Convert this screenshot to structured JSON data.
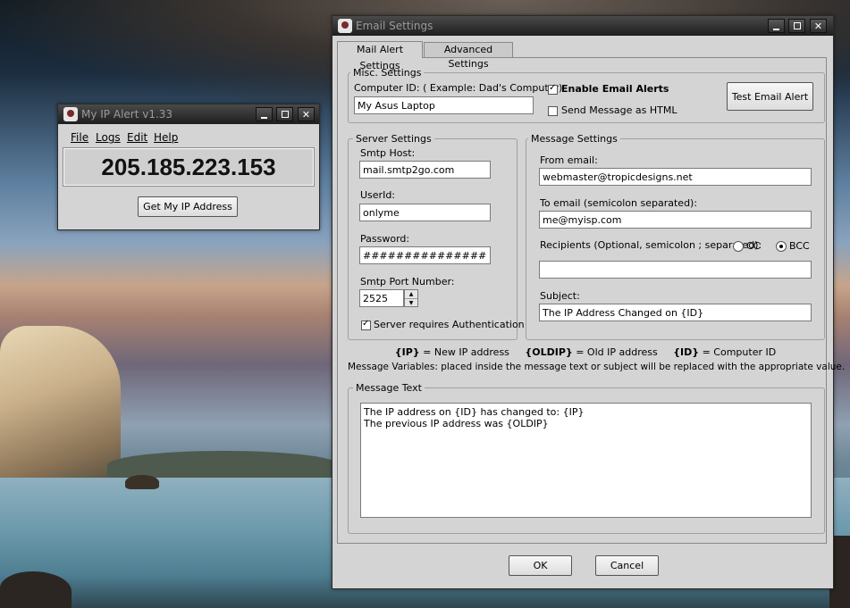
{
  "ipwin": {
    "title": "My IP Alert v1.33",
    "menu": [
      "File",
      "Logs",
      "Edit",
      "Help"
    ],
    "ip": "205.185.223.153",
    "get_ip_button": "Get My IP Address"
  },
  "email": {
    "title": "Email Settings",
    "tabs": [
      "Mail Alert Settings",
      "Advanced Settings"
    ],
    "misc": {
      "legend": "Misc. Settings",
      "computer_id_label": "Computer ID: ( Example: Dad's Computer)",
      "computer_id_value": "My Asus Laptop",
      "enable_alerts_label": "Enable Email Alerts",
      "send_html_label": "Send Message as HTML",
      "test_button": "Test Email Alert"
    },
    "server": {
      "legend": "Server Settings",
      "smtp_host_label": "Smtp Host:",
      "smtp_host_value": "mail.smtp2go.com",
      "userid_label": "UserId:",
      "userid_value": "onlyme",
      "password_label": "Password:",
      "password_value": "#################",
      "port_label": "Smtp Port Number:",
      "port_value": "2525",
      "auth_label": "Server requires Authentication"
    },
    "message": {
      "legend": "Message Settings",
      "from_label": "From email:",
      "from_value": "webmaster@tropicdesigns.net",
      "to_label": "To email (semicolon separated):",
      "to_value": "me@myisp.com",
      "recipients_label": "Recipients (Optional, semicolon ; separated):",
      "cc_label": "CC",
      "bcc_label": "BCC",
      "recipients_value": "",
      "subject_label": "Subject:",
      "subject_value": "The IP Address Changed on {ID}"
    },
    "vars": {
      "ip_token": "{IP}",
      "ip_desc": " = New IP address",
      "oldip_token": "{OLDIP}",
      "oldip_desc": " = Old IP address",
      "id_token": "{ID}",
      "id_desc": " = Computer ID",
      "note": "Message Variables: placed inside the message text or subject will be replaced with the appropriate value."
    },
    "text": {
      "legend": "Message Text",
      "body": "The IP address on {ID} has changed to: {IP}\nThe previous IP address was {OLDIP}"
    },
    "ok_button": "OK",
    "cancel_button": "Cancel"
  }
}
